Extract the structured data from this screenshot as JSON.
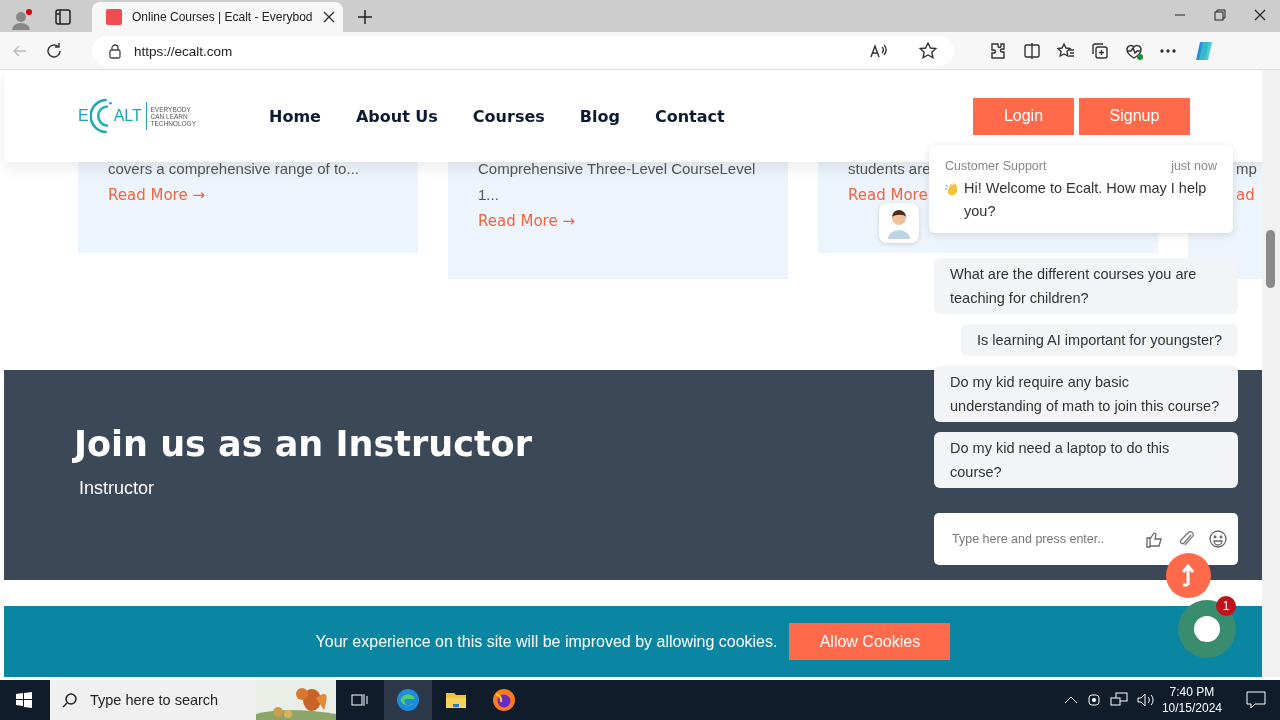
{
  "browser": {
    "tabs": [
      {
        "title": "Online Courses | Ecalt - Everybod",
        "selected": true
      }
    ],
    "url": "https://ecalt.com"
  },
  "header": {
    "logo": {
      "letter": "E",
      "word": "ALT",
      "tagline": [
        "EVERYBODY",
        "CAN LEARN",
        "TECHNOLOGY"
      ]
    },
    "nav": [
      "Home",
      "About Us",
      "Courses",
      "Blog",
      "Contact"
    ],
    "buttons": [
      "Login",
      "Signup"
    ]
  },
  "cards": [
    {
      "text": "covers a comprehensive range of to...",
      "link": "Read More →"
    },
    {
      "text": "Comprehensive Three-Level CourseLevel 1...",
      "link": "Read More →"
    },
    {
      "text": "students are",
      "link": "Read More"
    },
    {
      "text": "mp",
      "link": "ad"
    }
  ],
  "instructor": {
    "title": "Join us as an Instructor",
    "subtitle": "Instructor"
  },
  "cookie": {
    "message": "Your experience on this site will be improved by allowing cookies.",
    "button": "Allow Cookies"
  },
  "chat": {
    "agent": "Customer Support",
    "time": "just now",
    "greeting": "Hi! Welcome to Ecalt. How may I help you?",
    "suggestions": [
      "What are the different courses you are teaching for children?",
      "Is learning AI important for youngster?",
      "Do my kid require any basic understanding of math to join this course?",
      "Do my kid need a laptop to do this course?"
    ],
    "input": {
      "placeholder": "Type here and press enter.."
    },
    "badge": "1"
  },
  "taskbar": {
    "search": {
      "placeholder": "Type here to search"
    },
    "time": "7:40 PM",
    "date": "10/15/2024"
  }
}
